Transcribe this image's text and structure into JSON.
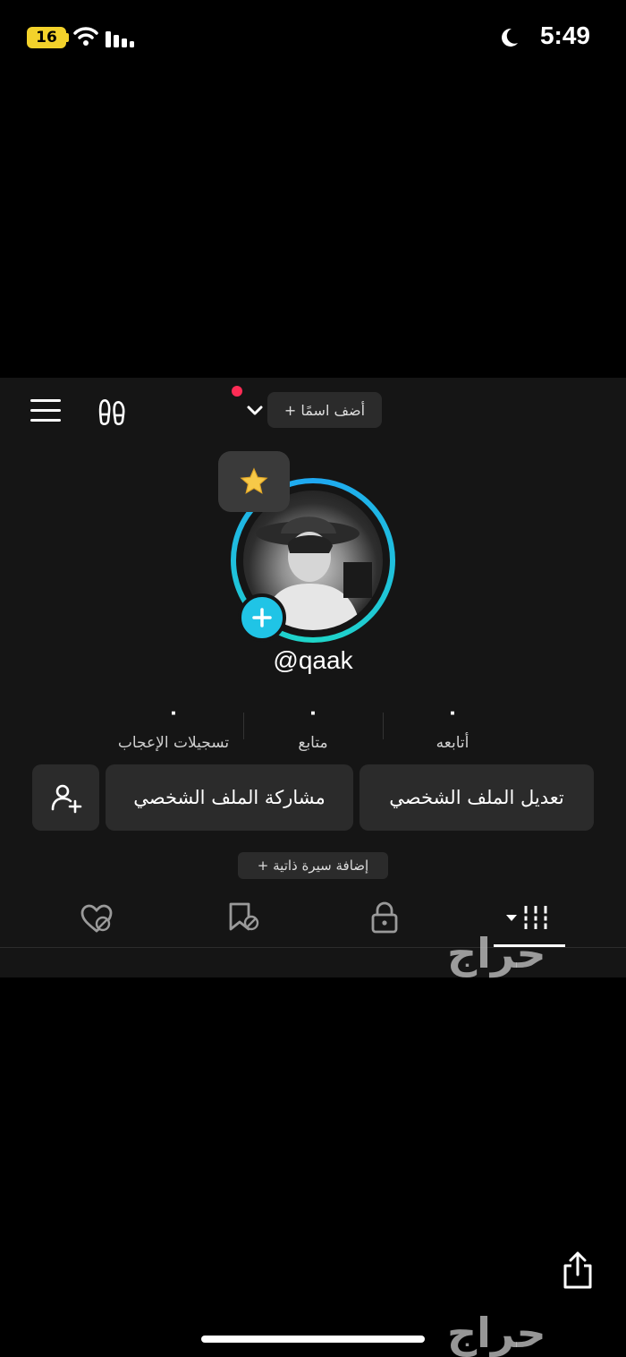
{
  "status_bar": {
    "battery": "16",
    "time": "5:49",
    "icons": [
      "wifi-icon",
      "signal-icon",
      "moon-icon"
    ]
  },
  "header": {
    "add_name": "+ أضف اسمًا",
    "icons": [
      "menu-icon",
      "footprints-icon",
      "chevron-down-icon"
    ],
    "notification_dot_color": "#fe2c55"
  },
  "profile": {
    "handle": "@qaak",
    "badge_icon": "star-icon",
    "accent_color": "#20c4e6"
  },
  "stats": [
    {
      "value": "٠",
      "label": "أتابعه"
    },
    {
      "value": "٠",
      "label": "متابع"
    },
    {
      "value": "٠",
      "label": "تسجيلات الإعجاب"
    }
  ],
  "actions": {
    "edit_profile": "تعديل الملف الشخصي",
    "share_profile": "مشاركة الملف الشخصي",
    "add_friend_icon": "add-user-icon"
  },
  "bio": {
    "add_bio": "+ إضافة سيرة ذاتية"
  },
  "tabs": [
    "videos-grid-icon",
    "lock-icon",
    "hidden-bookmark-icon",
    "hidden-heart-icon"
  ],
  "watermark": "حراج"
}
